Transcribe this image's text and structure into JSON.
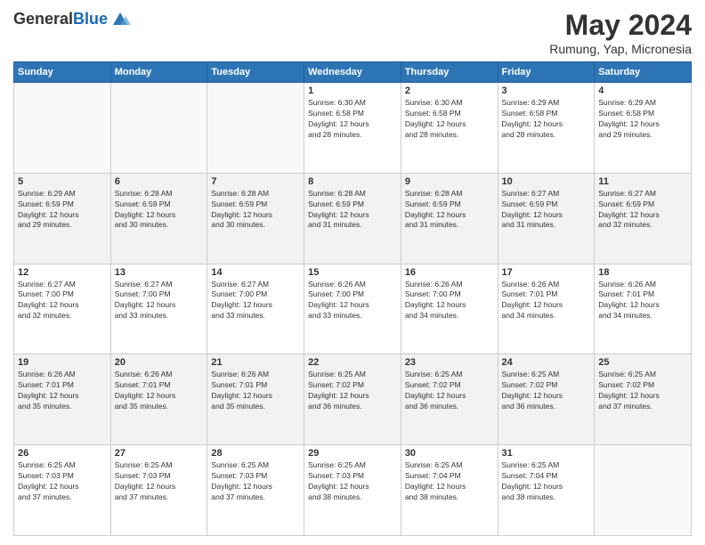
{
  "header": {
    "logo_line1": "General",
    "logo_line2": "Blue",
    "month_title": "May 2024",
    "location": "Rumung, Yap, Micronesia"
  },
  "weekdays": [
    "Sunday",
    "Monday",
    "Tuesday",
    "Wednesday",
    "Thursday",
    "Friday",
    "Saturday"
  ],
  "weeks": [
    [
      {
        "day": "",
        "info": ""
      },
      {
        "day": "",
        "info": ""
      },
      {
        "day": "",
        "info": ""
      },
      {
        "day": "1",
        "info": "Sunrise: 6:30 AM\nSunset: 6:58 PM\nDaylight: 12 hours\nand 28 minutes."
      },
      {
        "day": "2",
        "info": "Sunrise: 6:30 AM\nSunset: 6:58 PM\nDaylight: 12 hours\nand 28 minutes."
      },
      {
        "day": "3",
        "info": "Sunrise: 6:29 AM\nSunset: 6:58 PM\nDaylight: 12 hours\nand 28 minutes."
      },
      {
        "day": "4",
        "info": "Sunrise: 6:29 AM\nSunset: 6:58 PM\nDaylight: 12 hours\nand 29 minutes."
      }
    ],
    [
      {
        "day": "5",
        "info": "Sunrise: 6:29 AM\nSunset: 6:59 PM\nDaylight: 12 hours\nand 29 minutes."
      },
      {
        "day": "6",
        "info": "Sunrise: 6:28 AM\nSunset: 6:59 PM\nDaylight: 12 hours\nand 30 minutes."
      },
      {
        "day": "7",
        "info": "Sunrise: 6:28 AM\nSunset: 6:59 PM\nDaylight: 12 hours\nand 30 minutes."
      },
      {
        "day": "8",
        "info": "Sunrise: 6:28 AM\nSunset: 6:59 PM\nDaylight: 12 hours\nand 31 minutes."
      },
      {
        "day": "9",
        "info": "Sunrise: 6:28 AM\nSunset: 6:59 PM\nDaylight: 12 hours\nand 31 minutes."
      },
      {
        "day": "10",
        "info": "Sunrise: 6:27 AM\nSunset: 6:59 PM\nDaylight: 12 hours\nand 31 minutes."
      },
      {
        "day": "11",
        "info": "Sunrise: 6:27 AM\nSunset: 6:59 PM\nDaylight: 12 hours\nand 32 minutes."
      }
    ],
    [
      {
        "day": "12",
        "info": "Sunrise: 6:27 AM\nSunset: 7:00 PM\nDaylight: 12 hours\nand 32 minutes."
      },
      {
        "day": "13",
        "info": "Sunrise: 6:27 AM\nSunset: 7:00 PM\nDaylight: 12 hours\nand 33 minutes."
      },
      {
        "day": "14",
        "info": "Sunrise: 6:27 AM\nSunset: 7:00 PM\nDaylight: 12 hours\nand 33 minutes."
      },
      {
        "day": "15",
        "info": "Sunrise: 6:26 AM\nSunset: 7:00 PM\nDaylight: 12 hours\nand 33 minutes."
      },
      {
        "day": "16",
        "info": "Sunrise: 6:26 AM\nSunset: 7:00 PM\nDaylight: 12 hours\nand 34 minutes."
      },
      {
        "day": "17",
        "info": "Sunrise: 6:26 AM\nSunset: 7:01 PM\nDaylight: 12 hours\nand 34 minutes."
      },
      {
        "day": "18",
        "info": "Sunrise: 6:26 AM\nSunset: 7:01 PM\nDaylight: 12 hours\nand 34 minutes."
      }
    ],
    [
      {
        "day": "19",
        "info": "Sunrise: 6:26 AM\nSunset: 7:01 PM\nDaylight: 12 hours\nand 35 minutes."
      },
      {
        "day": "20",
        "info": "Sunrise: 6:26 AM\nSunset: 7:01 PM\nDaylight: 12 hours\nand 35 minutes."
      },
      {
        "day": "21",
        "info": "Sunrise: 6:26 AM\nSunset: 7:01 PM\nDaylight: 12 hours\nand 35 minutes."
      },
      {
        "day": "22",
        "info": "Sunrise: 6:25 AM\nSunset: 7:02 PM\nDaylight: 12 hours\nand 36 minutes."
      },
      {
        "day": "23",
        "info": "Sunrise: 6:25 AM\nSunset: 7:02 PM\nDaylight: 12 hours\nand 36 minutes."
      },
      {
        "day": "24",
        "info": "Sunrise: 6:25 AM\nSunset: 7:02 PM\nDaylight: 12 hours\nand 36 minutes."
      },
      {
        "day": "25",
        "info": "Sunrise: 6:25 AM\nSunset: 7:02 PM\nDaylight: 12 hours\nand 37 minutes."
      }
    ],
    [
      {
        "day": "26",
        "info": "Sunrise: 6:25 AM\nSunset: 7:03 PM\nDaylight: 12 hours\nand 37 minutes."
      },
      {
        "day": "27",
        "info": "Sunrise: 6:25 AM\nSunset: 7:03 PM\nDaylight: 12 hours\nand 37 minutes."
      },
      {
        "day": "28",
        "info": "Sunrise: 6:25 AM\nSunset: 7:03 PM\nDaylight: 12 hours\nand 37 minutes."
      },
      {
        "day": "29",
        "info": "Sunrise: 6:25 AM\nSunset: 7:03 PM\nDaylight: 12 hours\nand 38 minutes."
      },
      {
        "day": "30",
        "info": "Sunrise: 6:25 AM\nSunset: 7:04 PM\nDaylight: 12 hours\nand 38 minutes."
      },
      {
        "day": "31",
        "info": "Sunrise: 6:25 AM\nSunset: 7:04 PM\nDaylight: 12 hours\nand 38 minutes."
      },
      {
        "day": "",
        "info": ""
      }
    ]
  ]
}
